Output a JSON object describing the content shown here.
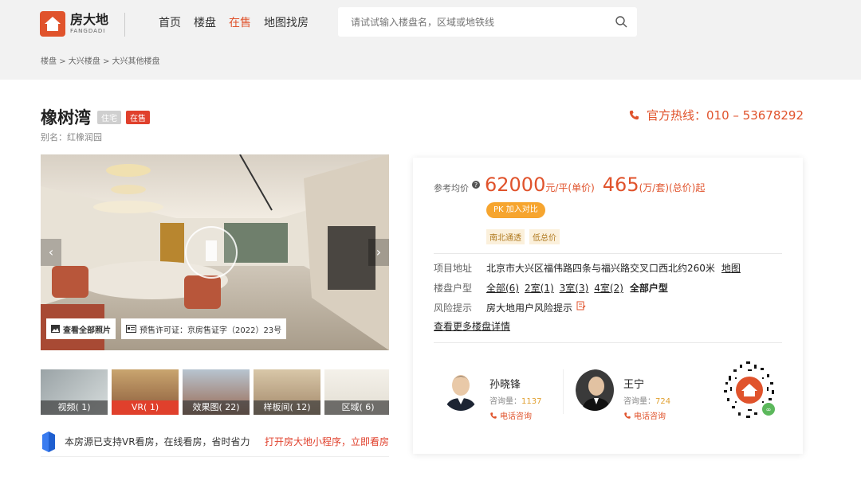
{
  "header": {
    "logo_cn": "房大地",
    "logo_en": "FANGDADI",
    "nav": [
      "首页",
      "楼盘",
      "在售",
      "地图找房"
    ],
    "nav_active_index": 2,
    "search_placeholder": "请试试输入楼盘名，区域或地铁线"
  },
  "breadcrumb": [
    "楼盘",
    "大兴楼盘",
    "大兴其他楼盘"
  ],
  "breadcrumb_sep": ">",
  "property": {
    "name": "橡树湾",
    "tag_type": "住宅",
    "tag_status": "在售",
    "alias": "别名：红橡润园"
  },
  "hotline": "官方热线：010 – 53678292",
  "gallery": {
    "view_all": "查看全部照片",
    "permit": "预售许可证：京房售证字（2022）23号",
    "thumbs": [
      "视频( 1)",
      "VR( 1)",
      "效果图( 22)",
      "样板间( 12)",
      "区域( 6)"
    ],
    "active_thumb": 1
  },
  "vr_tip": {
    "text": "本房源已支持VR看房，在线看房，省时省力",
    "link": "打开房大地小程序，立即看房"
  },
  "panel": {
    "price_label": "参考均价",
    "unit_price": "62000",
    "unit_price_suffix": "元/平(单价)",
    "total_price": "465",
    "total_price_suffix": "(万/套)(总价)起",
    "compare_btn": "PK 加入对比",
    "tags": [
      "南北通透",
      "低总价"
    ],
    "address_label": "项目地址",
    "address": "北京市大兴区福伟路四条与福兴路交叉口西北约260米",
    "map_link": "地图",
    "layout_label": "楼盘户型",
    "layouts": [
      "全部(6)",
      "2室(1)",
      "3室(3)",
      "4室(2)",
      "全部户型"
    ],
    "risk_label": "风险提示",
    "risk_text": "房大地用户风险提示",
    "more_link": "查看更多楼盘详情"
  },
  "agents": [
    {
      "name": "孙晓锋",
      "count_label": "咨询量：",
      "count": "1137",
      "call": "电话咨询"
    },
    {
      "name": "王宁",
      "count_label": "咨询量：",
      "count": "724",
      "call": "电话咨询"
    }
  ],
  "colors": {
    "accent": "#e0532c",
    "price": "#e0532c",
    "badge_red": "#e0402c",
    "compare": "#f6a52f"
  }
}
